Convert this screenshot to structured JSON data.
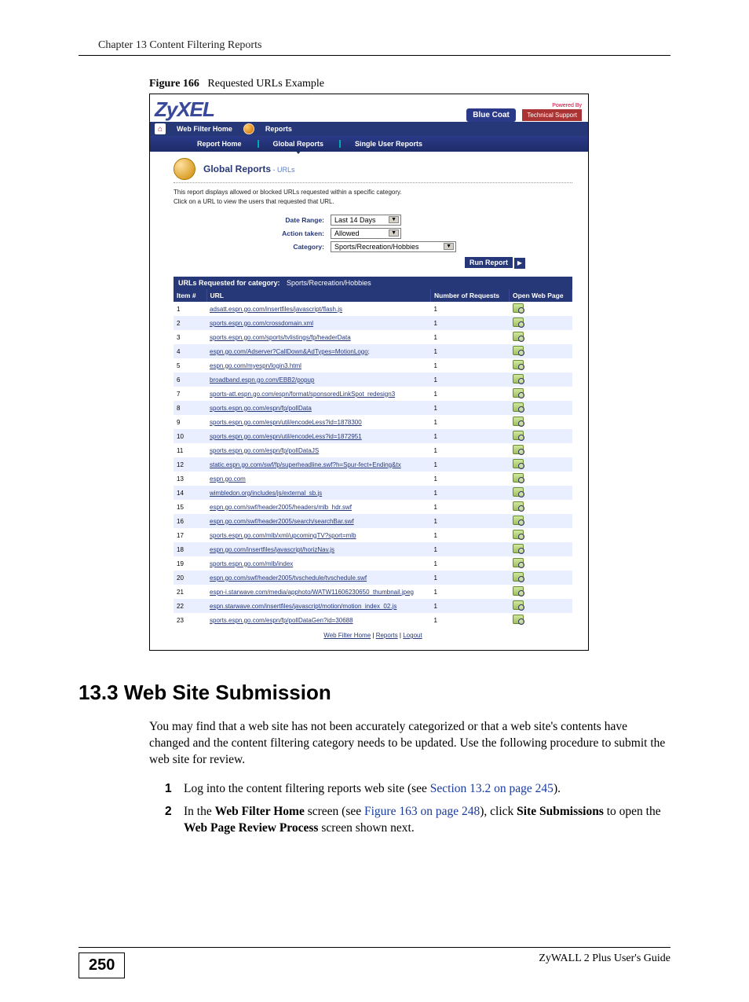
{
  "chapter_header": "Chapter 13 Content Filtering Reports",
  "figure": {
    "label": "Figure 166",
    "title": "Requested URLs Example"
  },
  "screenshot": {
    "logo": "ZyXEL",
    "powered_by": "Powered By",
    "bluecoat": "Blue Coat",
    "tech_support": "Technical Support",
    "tabs1": {
      "home": "Web Filter Home",
      "reports": "Reports"
    },
    "tabs2": {
      "report_home": "Report Home",
      "global": "Global Reports",
      "single": "Single User Reports"
    },
    "page_title": "Global Reports",
    "page_subtitle": "- URLs",
    "desc1": "This report displays allowed or blocked URLs requested within a specific category.",
    "desc2": "Click on a URL to view the users that requested that URL.",
    "filters": {
      "date_label": "Date Range:",
      "date_value": "Last 14 Days",
      "action_label": "Action taken:",
      "action_value": "Allowed",
      "cat_label": "Category:",
      "cat_value": "Sports/Recreation/Hobbies"
    },
    "run_report": "Run Report",
    "table_caption_prefix": "URLs Requested for category:",
    "table_caption_cat": "Sports/Recreation/Hobbies",
    "columns": {
      "item": "Item #",
      "url": "URL",
      "requests": "Number of Requests",
      "open": "Open Web Page"
    },
    "rows": [
      {
        "n": "1",
        "url": "adsatt.espn.go.com/insertfiles/javascript/flash.js",
        "req": "1"
      },
      {
        "n": "2",
        "url": "sports.espn.go.com/crossdomain.xml",
        "req": "1"
      },
      {
        "n": "3",
        "url": "sports.espn.go.com/sports/tvlistings/fp/headerData",
        "req": "1"
      },
      {
        "n": "4",
        "url": "espn.go.com/Adserver?CallDown&AdTypes=MotionLogo;",
        "req": "1"
      },
      {
        "n": "5",
        "url": "espn.go.com/myespn/login3.html",
        "req": "1"
      },
      {
        "n": "6",
        "url": "broadband.espn.go.com/EBB2/popup",
        "req": "1"
      },
      {
        "n": "7",
        "url": "sports-att.espn.go.com/espn/format/sponsoredLinkSpot_redesign3",
        "req": "1"
      },
      {
        "n": "8",
        "url": "sports.espn.go.com/espn/fp/pollData",
        "req": "1"
      },
      {
        "n": "9",
        "url": "sports.espn.go.com/espn/util/encodeLess?id=1878300",
        "req": "1"
      },
      {
        "n": "10",
        "url": "sports.espn.go.com/espn/util/encodeLess?id=1872951",
        "req": "1"
      },
      {
        "n": "11",
        "url": "sports.espn.go.com/espn/fp/pollDataJS",
        "req": "1"
      },
      {
        "n": "12",
        "url": "static.espn.go.com/swf/fp/superheadline.swf?h=Spur-fect+Ending&tx",
        "req": "1"
      },
      {
        "n": "13",
        "url": "espn.go.com",
        "req": "1"
      },
      {
        "n": "14",
        "url": "wimbledon.org/includes/js/external_sb.js",
        "req": "1"
      },
      {
        "n": "15",
        "url": "espn.go.com/swf/header2005/headers/mlb_hdr.swf",
        "req": "1"
      },
      {
        "n": "16",
        "url": "espn.go.com/swf/header2005/search/searchBar.swf",
        "req": "1"
      },
      {
        "n": "17",
        "url": "sports.espn.go.com/mlb/xml/upcomingTV?sport=mlb",
        "req": "1"
      },
      {
        "n": "18",
        "url": "espn.go.com/insertfiles/javascript/horizNav.js",
        "req": "1"
      },
      {
        "n": "19",
        "url": "sports.espn.go.com/mlb/index",
        "req": "1"
      },
      {
        "n": "20",
        "url": "espn.go.com/swf/header2005/tvschedule/tvschedule.swf",
        "req": "1"
      },
      {
        "n": "21",
        "url": "espn-i.starwave.com/media/apphoto/WATW11606230650_thumbnail.jpeg",
        "req": "1"
      },
      {
        "n": "22",
        "url": "espn.starwave.com/insertfiles/javascript/motion/motion_index_02.js",
        "req": "1"
      },
      {
        "n": "23",
        "url": "sports.espn.go.com/espn/fp/pollDataGen?id=30688",
        "req": "1"
      }
    ],
    "footer_links": {
      "home": "Web Filter Home",
      "reports": "Reports",
      "logout": "Logout"
    }
  },
  "section": {
    "heading": "13.3  Web Site Submission",
    "para": "You may find that a web site has not been accurately categorized or that a web site's contents have changed and the content filtering category needs to be updated. Use the following procedure to submit the web site for review.",
    "step1_a": "Log into the content filtering reports web site (see ",
    "step1_link": "Section 13.2 on page 245",
    "step1_b": ").",
    "step2_a": "In the ",
    "step2_bold1": "Web Filter Home",
    "step2_b": " screen (see ",
    "step2_link": "Figure 163 on page 248",
    "step2_c": "), click ",
    "step2_bold2": "Site Submissions",
    "step2_d": " to open the ",
    "step2_bold3": "Web Page Review Process",
    "step2_e": " screen shown next."
  },
  "footer": {
    "page_num": "250",
    "guide": "ZyWALL 2 Plus User's Guide"
  }
}
